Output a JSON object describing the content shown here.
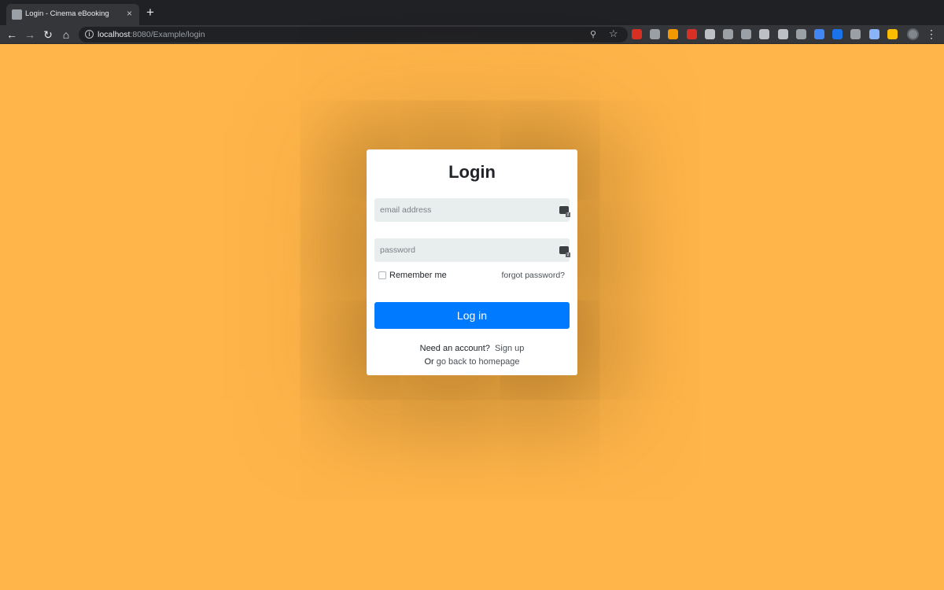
{
  "browser": {
    "tab_title": "Login - Cinema eBooking",
    "tab_close": "×",
    "new_tab": "+",
    "url_host": "localhost",
    "url_rest": ":8080/Example/login",
    "extensions": [
      {
        "name": "ublock-icon",
        "color": "#d93025"
      },
      {
        "name": "drive-icon",
        "color": "#9aa0a6"
      },
      {
        "name": "chart-extension-icon",
        "color": "#f29900"
      },
      {
        "name": "youtube-extension-icon",
        "color": "#d93025"
      },
      {
        "name": "evernote-icon",
        "color": "#bdc1c6"
      },
      {
        "name": "screen-extension-icon",
        "color": "#9aa0a6"
      },
      {
        "name": "dollar-extension-icon",
        "color": "#9aa0a6"
      },
      {
        "name": "json-extension-icon",
        "color": "#bdc1c6"
      },
      {
        "name": "print-extension-icon",
        "color": "#bdc1c6"
      },
      {
        "name": "css-extension-icon",
        "color": "#9aa0a6"
      },
      {
        "name": "clock-12h-icon",
        "color": "#4285f4"
      },
      {
        "name": "calendar-31-icon",
        "color": "#1a73e8"
      },
      {
        "name": "mask-extension-icon",
        "color": "#9aa0a6"
      },
      {
        "name": "bird-extension-icon",
        "color": "#8ab4f8"
      },
      {
        "name": "sticky-note-icon",
        "color": "#fbbc04"
      }
    ]
  },
  "login": {
    "title": "Login",
    "email_placeholder": "email address",
    "password_placeholder": "password",
    "password_manager_count": "2",
    "remember_label": "Remember me",
    "forgot_label": "forgot password?",
    "submit_label": "Log in",
    "signup_prompt": "Need an account?",
    "signup_link": "Sign up",
    "home_prefix": "Or",
    "home_link": "go back to homepage"
  },
  "colors": {
    "page_background": "#ffb54a",
    "primary_button": "#007bff"
  }
}
